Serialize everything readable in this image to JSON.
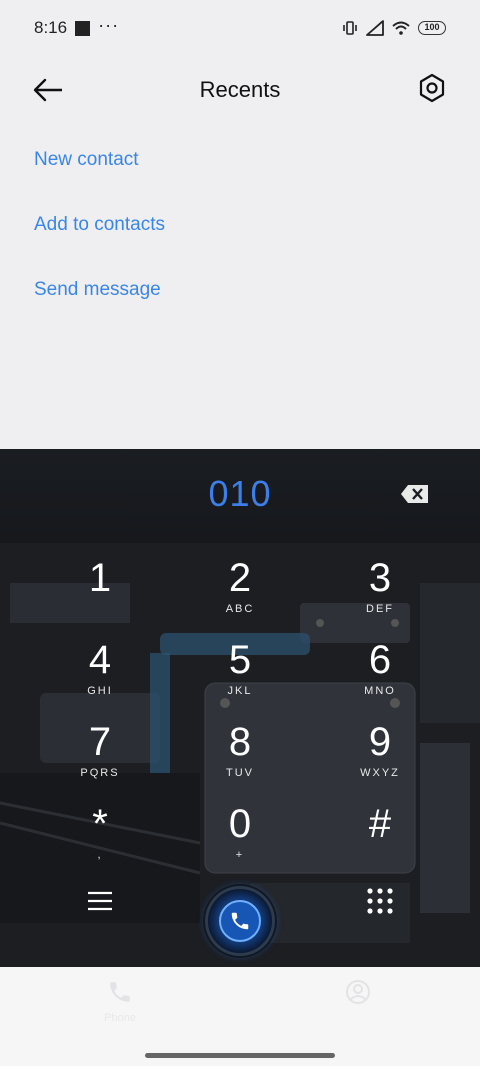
{
  "status_bar": {
    "time": "8:16",
    "dots": "···",
    "battery": "100"
  },
  "header": {
    "title": "Recents",
    "back_icon": "arrow-left-icon",
    "settings_icon": "gear-icon"
  },
  "actions": [
    {
      "label": "New contact"
    },
    {
      "label": "Add to contacts"
    },
    {
      "label": "Send message"
    }
  ],
  "dialer": {
    "number": "010",
    "keys": [
      {
        "digit": "1",
        "letters": ""
      },
      {
        "digit": "2",
        "letters": "ABC"
      },
      {
        "digit": "3",
        "letters": "DEF"
      },
      {
        "digit": "4",
        "letters": "GHI"
      },
      {
        "digit": "5",
        "letters": "JKL"
      },
      {
        "digit": "6",
        "letters": "MNO"
      },
      {
        "digit": "7",
        "letters": "PQRS"
      },
      {
        "digit": "8",
        "letters": "TUV"
      },
      {
        "digit": "9",
        "letters": "WXYZ"
      },
      {
        "digit": "*",
        "letters": ","
      },
      {
        "digit": "0",
        "letters": "+"
      },
      {
        "digit": "#",
        "letters": ""
      }
    ],
    "accent_color": "#3d7fe8"
  },
  "bottom_nav": {
    "tabs": [
      {
        "label": "Phone",
        "icon": "phone-icon"
      },
      {
        "label": "",
        "icon": "contacts-icon"
      }
    ]
  },
  "colors": {
    "link": "#3a86e6",
    "background": "#efeff1"
  }
}
